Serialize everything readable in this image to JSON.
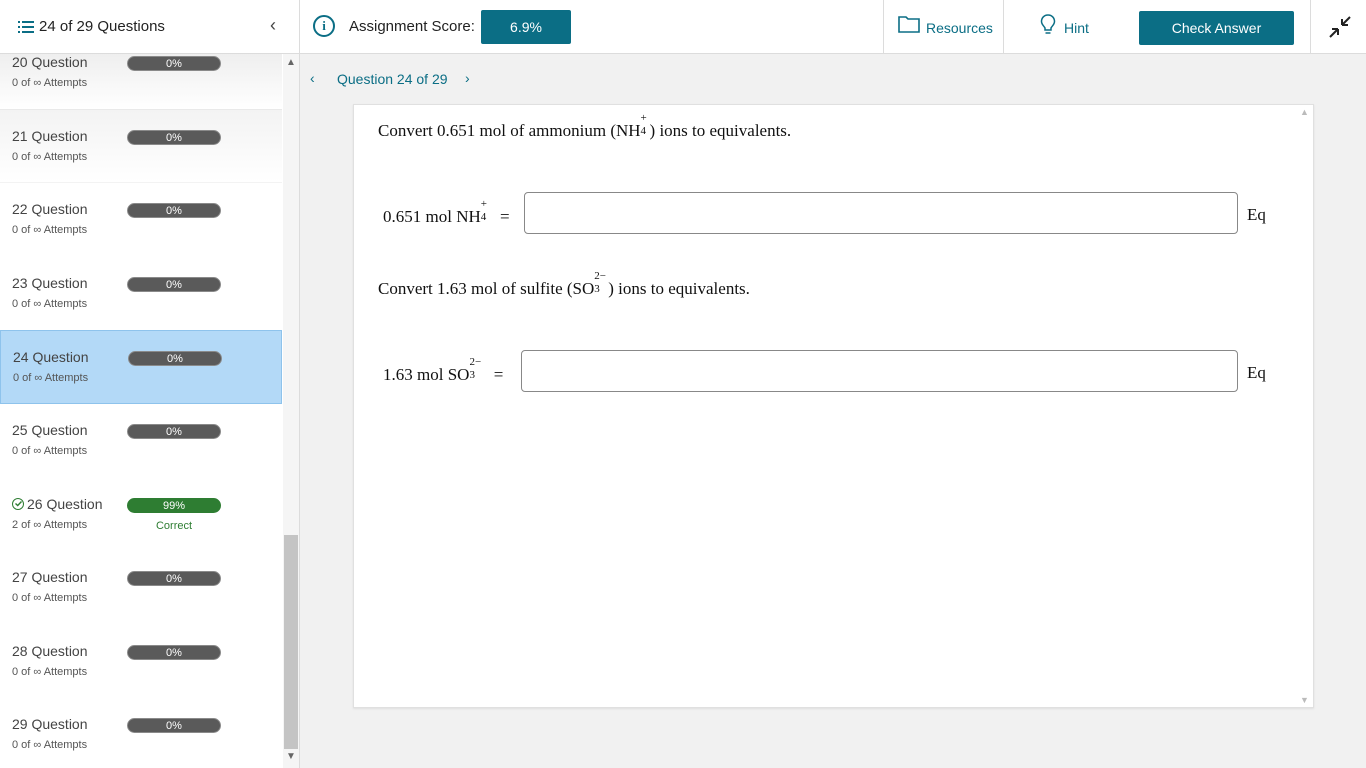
{
  "header": {
    "question_count_label": "24 of 29 Questions",
    "score_label": "Assignment Score:",
    "score_value": "6.9%",
    "resources_label": "Resources",
    "hint_label": "Hint",
    "check_answer_label": "Check Answer"
  },
  "sidebar": {
    "items": [
      {
        "name": "20 Question",
        "attempts": "0 of ∞ Attempts",
        "percent": "0%"
      },
      {
        "name": "21 Question",
        "attempts": "0 of ∞ Attempts",
        "percent": "0%"
      },
      {
        "name": "22 Question",
        "attempts": "0 of ∞ Attempts",
        "percent": "0%"
      },
      {
        "name": "23 Question",
        "attempts": "0 of ∞ Attempts",
        "percent": "0%"
      },
      {
        "name": "24 Question",
        "attempts": "0 of ∞ Attempts",
        "percent": "0%"
      },
      {
        "name": "25 Question",
        "attempts": "0 of ∞ Attempts",
        "percent": "0%"
      },
      {
        "name": "26 Question",
        "attempts": "2 of ∞ Attempts",
        "percent": "99%",
        "status": "Correct"
      },
      {
        "name": "27 Question",
        "attempts": "0 of ∞ Attempts",
        "percent": "0%"
      },
      {
        "name": "28 Question",
        "attempts": "0 of ∞ Attempts",
        "percent": "0%"
      },
      {
        "name": "29 Question",
        "attempts": "0 of ∞ Attempts",
        "percent": "0%"
      }
    ]
  },
  "main": {
    "nav_title": "Question 24 of 29",
    "parts": [
      {
        "prompt_pre": "Convert 0.651 mol of ammonium (NH",
        "prompt_sub": "4",
        "prompt_sup": "+",
        "prompt_post": ") ions to equivalents.",
        "eq_pre": "0.651 mol NH",
        "eq_sub": "4",
        "eq_sup": "+",
        "eq_sign": "=",
        "answer_value": "",
        "unit": "Eq"
      },
      {
        "prompt_pre": "Convert 1.63 mol of sulfite (SO",
        "prompt_sub": "3",
        "prompt_sup": "2−",
        "prompt_post": ") ions to equivalents.",
        "eq_pre": "1.63 mol SO",
        "eq_sub": "3",
        "eq_sup": "2−",
        "eq_sign": "=",
        "answer_value": "",
        "unit": "Eq"
      }
    ]
  },
  "colors": {
    "accent": "#0b6e85",
    "active_row": "#b3d9f7",
    "correct": "#2e7d32",
    "bar_default": "#5a5a5a"
  }
}
